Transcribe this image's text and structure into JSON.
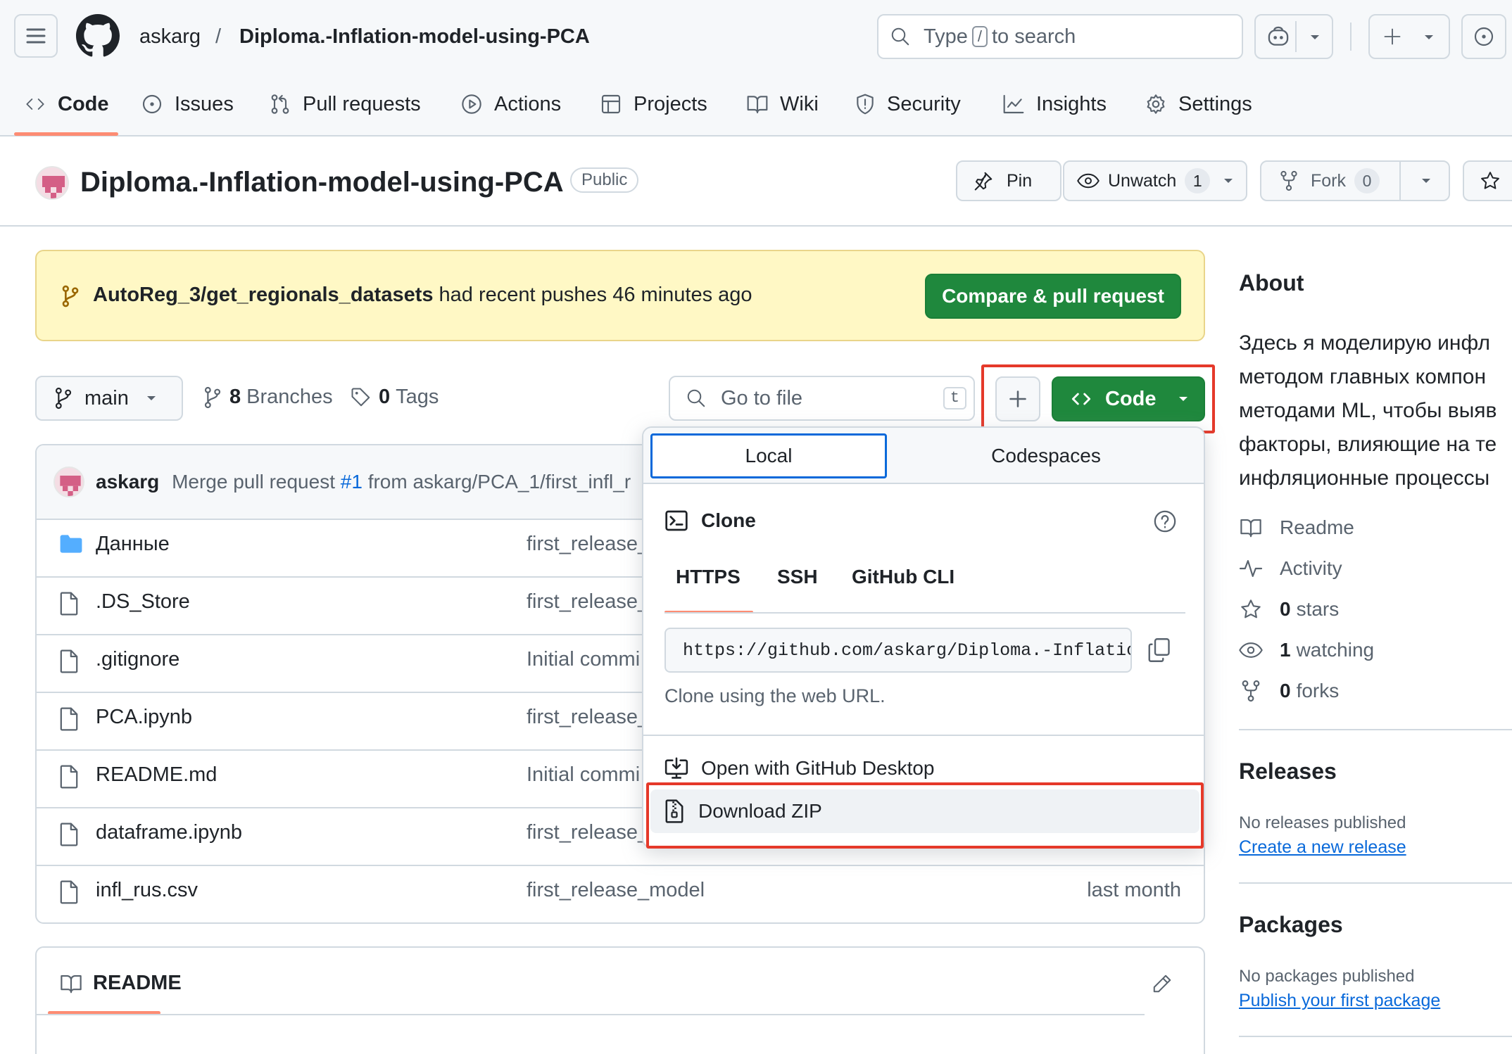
{
  "header": {
    "owner": "askarg",
    "separator": "/",
    "repo": "Diploma.-Inflation-model-using-PCA",
    "search_prefix": "Type",
    "search_key": "/",
    "search_suffix": "to search"
  },
  "nav": {
    "tabs": [
      {
        "label": "Code"
      },
      {
        "label": "Issues"
      },
      {
        "label": "Pull requests"
      },
      {
        "label": "Actions"
      },
      {
        "label": "Projects"
      },
      {
        "label": "Wiki"
      },
      {
        "label": "Security"
      },
      {
        "label": "Insights"
      },
      {
        "label": "Settings"
      }
    ]
  },
  "repo_header": {
    "name": "Diploma.-Inflation-model-using-PCA",
    "visibility": "Public",
    "pin": "Pin",
    "unwatch": "Unwatch",
    "watch_count": "1",
    "fork": "Fork",
    "fork_count": "0"
  },
  "banner": {
    "branch": "AutoReg_3/get_regionals_datasets",
    "text": "had recent pushes 46 minutes ago",
    "button": "Compare & pull request"
  },
  "toolbar": {
    "branch": "main",
    "branches_count": "8",
    "branches_label": "Branches",
    "tags_count": "0",
    "tags_label": "Tags",
    "goto_placeholder": "Go to file",
    "goto_key": "t",
    "code_button": "Code"
  },
  "commit": {
    "author": "askarg",
    "msg_prefix": "Merge pull request",
    "pr": "#1",
    "msg_suffix": "from askarg/PCA_1/first_infl_r"
  },
  "files": [
    {
      "name": "Данные",
      "type": "folder",
      "message": "first_release_",
      "date": ""
    },
    {
      "name": ".DS_Store",
      "type": "file",
      "message": "first_release_",
      "date": ""
    },
    {
      "name": ".gitignore",
      "type": "file",
      "message": "Initial commi",
      "date": ""
    },
    {
      "name": "PCA.ipynb",
      "type": "file",
      "message": "first_release_",
      "date": ""
    },
    {
      "name": "README.md",
      "type": "file",
      "message": "Initial commi",
      "date": ""
    },
    {
      "name": "dataframe.ipynb",
      "type": "file",
      "message": "first_release_",
      "date": ""
    },
    {
      "name": "infl_rus.csv",
      "type": "file",
      "message": "first_release_model",
      "date": "last month"
    }
  ],
  "readme": {
    "title": "README"
  },
  "dropdown": {
    "tab_local": "Local",
    "tab_codespaces": "Codespaces",
    "clone_title": "Clone",
    "subtabs": [
      "HTTPS",
      "SSH",
      "GitHub CLI"
    ],
    "url": "https://github.com/askarg/Diploma.-Inflation-model-using-PCA.git",
    "hint": "Clone using the web URL.",
    "open_desktop": "Open with GitHub Desktop",
    "download_zip": "Download ZIP"
  },
  "about": {
    "title": "About",
    "description_lines": [
      "Здесь я моделирую инфл",
      "методом главных компон",
      "методами ML, чтобы выяв",
      "факторы, влияющие на те",
      "инфляционные процессы"
    ],
    "readme": "Readme",
    "activity": "Activity",
    "stars_count": "0",
    "stars_label": "stars",
    "watching_count": "1",
    "watching_label": "watching",
    "forks_count": "0",
    "forks_label": "forks"
  },
  "releases": {
    "title": "Releases",
    "empty": "No releases published",
    "link": "Create a new release"
  },
  "packages": {
    "title": "Packages",
    "empty": "No packages published",
    "link": "Publish your first package"
  },
  "colors": {
    "accent_green": "#1f883d",
    "highlight_red": "#e5392a",
    "link_blue": "#0969da",
    "banner_bg": "#fff8c5",
    "tab_underline": "#fd8c73"
  }
}
